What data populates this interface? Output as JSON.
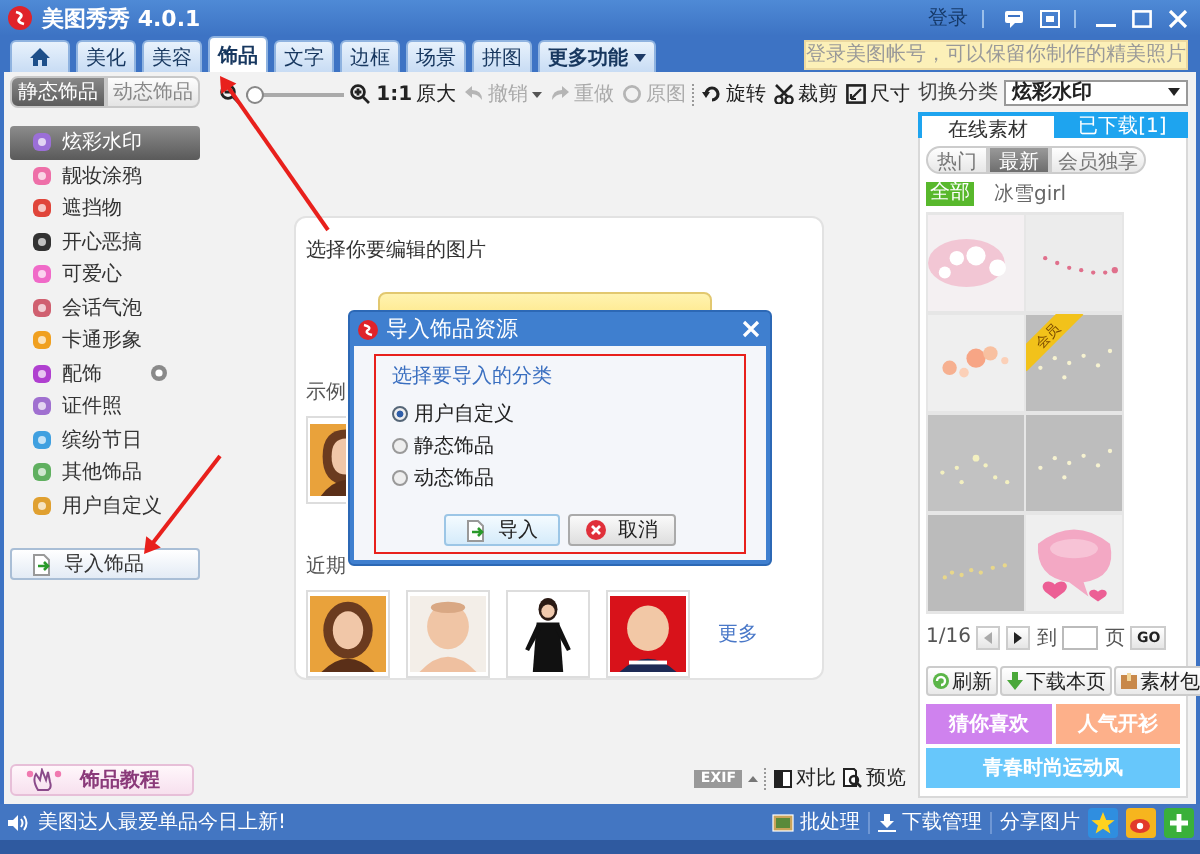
{
  "window": {
    "title": "美图秀秀 4.0.1",
    "login": "登录"
  },
  "tooltip": {
    "text": "登录美图帐号，可以保留你制作的精美照片"
  },
  "tabs": [
    {
      "kind": "home",
      "selected": false
    },
    {
      "kind": "text",
      "label": "美化",
      "selected": false
    },
    {
      "kind": "text",
      "label": "美容",
      "selected": false
    },
    {
      "kind": "text",
      "label": "饰品",
      "selected": true
    },
    {
      "kind": "text",
      "label": "文字",
      "selected": false
    },
    {
      "kind": "text",
      "label": "边框",
      "selected": false
    },
    {
      "kind": "text",
      "label": "场景",
      "selected": false
    },
    {
      "kind": "text",
      "label": "拼图",
      "selected": false
    },
    {
      "kind": "menu",
      "label": "更多功能",
      "selected": false
    }
  ],
  "subtabs": [
    {
      "label": "静态饰品",
      "selected": true
    },
    {
      "label": "动态饰品",
      "selected": false
    }
  ],
  "categories": [
    {
      "label": "炫彩水印",
      "selected": true,
      "options": false
    },
    {
      "label": "靓妆涂鸦",
      "selected": false,
      "options": false
    },
    {
      "label": "遮挡物",
      "selected": false,
      "options": false
    },
    {
      "label": "开心恶搞",
      "selected": false,
      "options": false
    },
    {
      "label": "可爱心",
      "selected": false,
      "options": false
    },
    {
      "label": "会话气泡",
      "selected": false,
      "options": false
    },
    {
      "label": "卡通形象",
      "selected": false,
      "options": false
    },
    {
      "label": "配饰",
      "selected": false,
      "options": true
    },
    {
      "label": "证件照",
      "selected": false,
      "options": false
    },
    {
      "label": "缤纷节日",
      "selected": false,
      "options": false
    },
    {
      "label": "其他饰品",
      "selected": false,
      "options": false
    },
    {
      "label": "用户自定义",
      "selected": false,
      "options": false
    }
  ],
  "import_button": "导入饰品",
  "tutorial_button": "饰品教程",
  "toolbar": {
    "zoom": {
      "level": 0
    },
    "actual_size": "**1:1** 原大",
    "actions": [
      {
        "kind": "undo",
        "label": "撤销",
        "disabled": true
      },
      {
        "kind": "redo",
        "label": "重做",
        "disabled": true
      },
      {
        "kind": "original",
        "label": "原图",
        "disabled": true
      },
      {
        "kind": "rotate",
        "label": "旋转",
        "disabled": false
      },
      {
        "kind": "crop",
        "label": "裁剪",
        "disabled": false
      },
      {
        "kind": "size",
        "label": "尺寸",
        "disabled": false
      }
    ]
  },
  "open_panel": {
    "prompt": "选择你要编辑的图片",
    "sample_label": "示例",
    "samples": [
      {
        "kind": "picture"
      }
    ],
    "recent_label": "近期",
    "recent": [
      {
        "kind": "picture"
      },
      {
        "kind": "picture"
      },
      {
        "kind": "picture"
      },
      {
        "kind": "picture"
      }
    ],
    "more": "更多"
  },
  "view_bar": {
    "exif": "EXIF",
    "compare": "对比",
    "preview": "预览"
  },
  "dialog": {
    "title": "导入饰品资源",
    "heading": "选择要导入的分类",
    "options": [
      {
        "label": "用户自定义",
        "selected": true
      },
      {
        "label": "静态饰品",
        "selected": false
      },
      {
        "label": "动态饰品",
        "selected": false
      }
    ],
    "buttons": [
      {
        "kind": "import",
        "label": "导入"
      },
      {
        "kind": "cancel",
        "label": "取消"
      }
    ]
  },
  "material_panel": {
    "switch_label": "切换分类",
    "category": "炫彩水印",
    "tabs": [
      {
        "label": "在线素材",
        "selected": true
      },
      {
        "label": "已下载[1]",
        "selected": false
      }
    ],
    "filters": [
      {
        "label": "热门",
        "selected": false
      },
      {
        "label": "最新",
        "selected": true
      },
      {
        "label": "会员独享",
        "selected": false
      }
    ],
    "tag": "全部",
    "author": "冰雪girl",
    "items": [
      {
        "kind": "picture"
      },
      {
        "kind": "picture"
      },
      {
        "kind": "picture"
      },
      {
        "kind": "picture",
        "badge": "会员"
      },
      {
        "kind": "picture"
      },
      {
        "kind": "picture"
      },
      {
        "kind": "picture"
      },
      {
        "kind": "picture"
      }
    ],
    "pager": {
      "page": "1/16",
      "goto": "到",
      "unit": "页",
      "go": "GO"
    },
    "actions": [
      {
        "kind": "refresh",
        "label": "刷新"
      },
      {
        "kind": "download",
        "label": "下载本页"
      },
      {
        "kind": "package",
        "label": "素材包"
      }
    ],
    "banners": [
      {
        "label": "猜你喜欢",
        "color": "#cf82ee"
      },
      {
        "label": "人气开衫",
        "color": "#fdb08a"
      },
      {
        "label": "青春时尚运动风",
        "color": "#67c7fb"
      }
    ]
  },
  "status_bar": {
    "news": "美图达人最爱单品今日上新!",
    "batch": "批处理",
    "downloads": "下载管理",
    "share": "分享图片"
  }
}
